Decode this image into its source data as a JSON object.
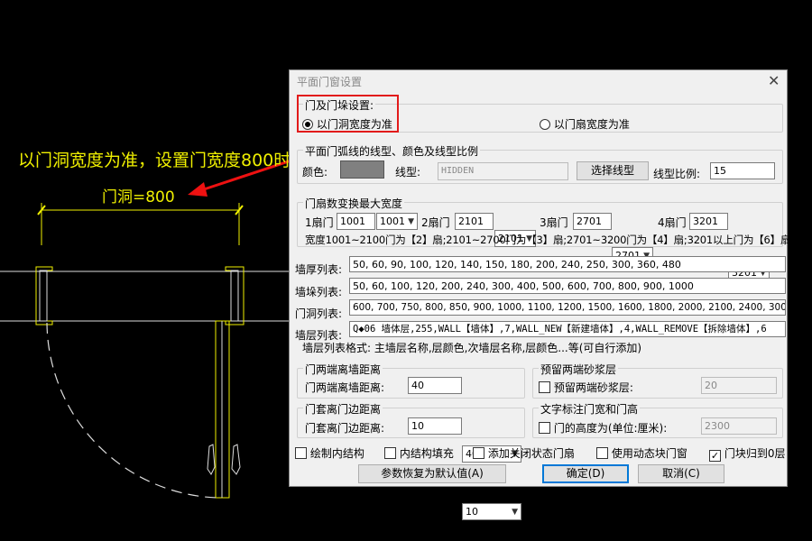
{
  "canvas": {
    "annotation": "以门洞宽度为准，设置门宽度800时",
    "dimension_label": "门洞=800"
  },
  "dialog": {
    "title": "平面门窗设置",
    "close_glyph": "✕",
    "door_setting": {
      "title": "门及门垛设置:",
      "option_hole": "以门洞宽度为准",
      "option_leaf": "以门扇宽度为准",
      "selected": "option_hole"
    },
    "arc_line": {
      "title": "平面门弧线的线型、颜色及线型比例",
      "color_label": "颜色:",
      "color_value": "#808080",
      "linetype_label": "线型:",
      "linetype_value": "HIDDEN",
      "select_button": "选择线型",
      "scale_label": "线型比例:",
      "scale_value": "15"
    },
    "leaf_width": {
      "title": "门扇数变换最大宽度",
      "items": [
        {
          "label": "1扇门",
          "input": "1001",
          "combo": "1001"
        },
        {
          "label": "2扇门",
          "input": "2101",
          "combo": "2101"
        },
        {
          "label": "3扇门",
          "input": "2701",
          "combo": "2701"
        },
        {
          "label": "4扇门",
          "input": "3201",
          "combo": "3201"
        }
      ],
      "note": "宽度1001~2100门为【2】扇;2101~2700门为【3】扇;2701~3200门为【4】扇;3201以上门为【6】扇"
    },
    "lists": {
      "wall_thickness_label": "墙厚列表:",
      "wall_thickness_value": "50, 60, 90, 100, 120, 140, 150, 180, 200, 240, 250, 300, 360, 480",
      "wall_pier_label": "墙垛列表:",
      "wall_pier_value": "50, 60, 100, 120, 200, 240, 300, 400, 500, 600, 700, 800, 900, 1000",
      "door_hole_label": "门洞列表:",
      "door_hole_value": "600, 700, 750, 800, 850, 900, 1000, 1100, 1200, 1500, 1600, 1800, 2000, 2100, 2400, 3000, 3200, 3",
      "wall_layer_label": "墙层列表:",
      "wall_layer_value": "Q◆06 墙体层,255,WALL【墙体】,7,WALL_NEW【新建墙体】,4,WALL_REMOVE【拆除墙体】,6",
      "format_note": "墙层列表格式: 主墙层名称,层颜色,次墙层名称,层颜色...等(可自行添加)"
    },
    "door_wall_dist": {
      "title": "门两端离墙距离",
      "label": "门两端离墙距离:",
      "input": "40",
      "combo": "40"
    },
    "mortar": {
      "title": "预留两端砂浆层",
      "label": "预留两端砂浆层:",
      "value": "20",
      "checked": false
    },
    "frame_dist": {
      "title": "门套离门边距离",
      "label": "门套离门边距离:",
      "input": "10",
      "combo": "10"
    },
    "text_label": {
      "title": "文字标注门宽和门高",
      "label": "门的高度为(单位:厘米):",
      "value": "2300",
      "checked": false
    },
    "bottom_checks": [
      {
        "label": "绘制内结构",
        "checked": false
      },
      {
        "label": "内结构填充",
        "checked": false
      },
      {
        "label": "添加关闭状态门扇",
        "checked": false
      },
      {
        "label": "使用动态块门窗",
        "checked": false
      },
      {
        "label": "门块归到0层",
        "checked": true
      }
    ],
    "buttons": {
      "reset": "参数恢复为默认值(A)",
      "ok": "确定(D)",
      "cancel": "取消(C)"
    }
  }
}
